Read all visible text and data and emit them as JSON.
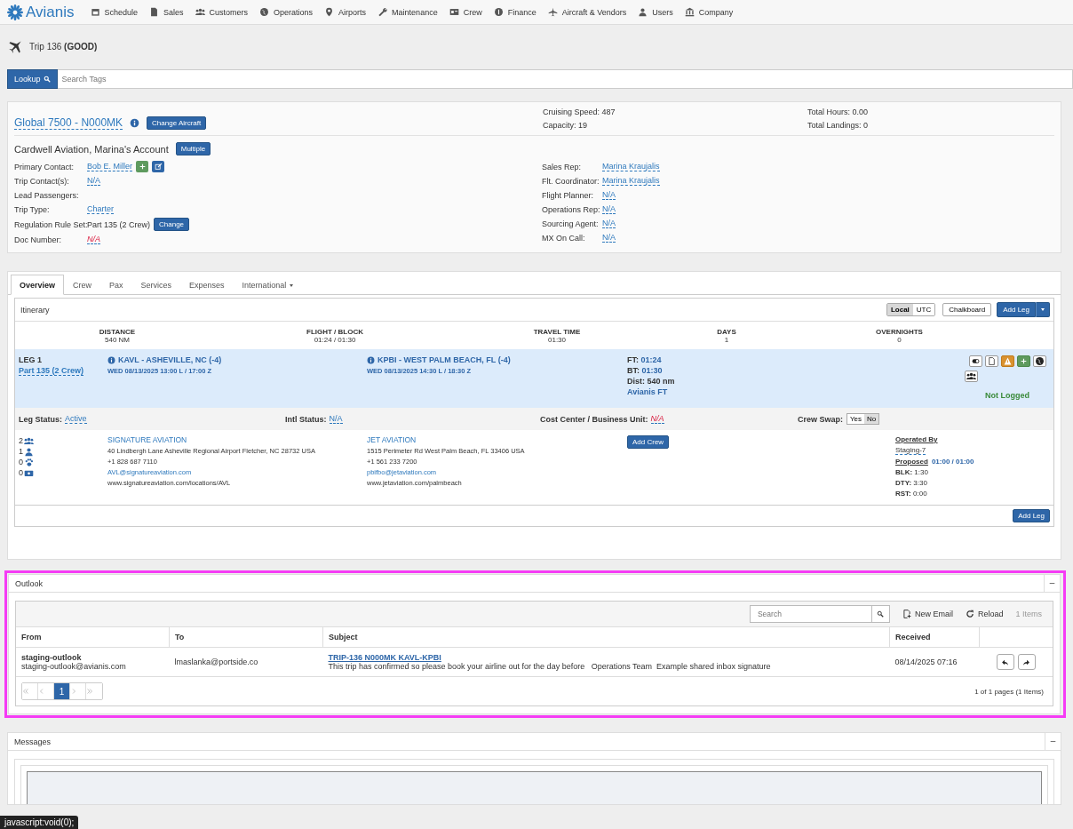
{
  "nav": {
    "logo": "Avianis",
    "items": [
      {
        "label": "Schedule",
        "kind": "calendar"
      },
      {
        "label": "Sales",
        "kind": "document"
      },
      {
        "label": "Customers",
        "kind": "group"
      },
      {
        "label": "Operations",
        "kind": "globe"
      },
      {
        "label": "Airports",
        "kind": "pin"
      },
      {
        "label": "Maintenance",
        "kind": "wrench"
      },
      {
        "label": "Crew",
        "kind": "card"
      },
      {
        "label": "Finance",
        "kind": "coin"
      },
      {
        "label": "Aircraft & Vendors",
        "kind": "plane"
      },
      {
        "label": "Users",
        "kind": "user"
      },
      {
        "label": "Company",
        "kind": "bank"
      }
    ]
  },
  "page_title": {
    "text": "Trip 136",
    "status": "(GOOD)"
  },
  "lookup": {
    "button": "Lookup",
    "placeholder": "Search Tags"
  },
  "trip": {
    "aircraft": "Global 7500 - N000MK",
    "change_aircraft": "Change Aircraft",
    "specs": [
      "Cruising Speed: 487",
      "Capacity: 19"
    ],
    "totals": [
      "Total Hours: 0.00",
      "Total Landings: 0"
    ],
    "account": "Cardwell Aviation, Marina's Account",
    "account_button": "Multiple",
    "left_fields": [
      {
        "label": "Primary Contact:",
        "value": "Bob E. Miller",
        "kind": "link",
        "actions": [
          {
            "kind": "add"
          },
          {
            "kind": "edit"
          }
        ]
      },
      {
        "label": "Trip Contact(s):",
        "value": "N/A",
        "kind": "link"
      },
      {
        "label": "Lead Passengers:",
        "kind": "empty"
      },
      {
        "label": "Trip Type:",
        "value": "Charter",
        "kind": "link"
      },
      {
        "label": "Regulation Rule Set:",
        "value": "Part 135 (2 Crew)",
        "kind": "plain",
        "button": "Change"
      },
      {
        "label": "Doc Number:",
        "value": "N/A",
        "kind": "missing"
      }
    ],
    "right_fields": [
      {
        "label": "Sales Rep:",
        "value": "Marina Kraujalis",
        "kind": "link"
      },
      {
        "label": "Flt. Coordinator:",
        "value": "Marina Kraujalis",
        "kind": "link"
      },
      {
        "label": "Flight Planner:",
        "value": "N/A",
        "kind": "link"
      },
      {
        "label": "Operations Rep:",
        "value": "N/A",
        "kind": "link"
      },
      {
        "label": "Sourcing Agent:",
        "value": "N/A",
        "kind": "link"
      },
      {
        "label": "MX On Call:",
        "value": "N/A",
        "kind": "link"
      }
    ]
  },
  "tabs": [
    {
      "label": "Overview",
      "selected": true,
      "has_menu": false
    },
    {
      "label": "Crew",
      "selected": false,
      "has_menu": false
    },
    {
      "label": "Pax",
      "selected": false,
      "has_menu": false
    },
    {
      "label": "Services",
      "selected": false,
      "has_menu": false
    },
    {
      "label": "Expenses",
      "selected": false,
      "has_menu": false
    },
    {
      "label": "International",
      "selected": false,
      "has_menu": true
    }
  ],
  "itinerary": {
    "title": "Itinerary",
    "time_modes": [
      {
        "label": "Local",
        "selected": true
      },
      {
        "label": "UTC",
        "selected": false
      }
    ],
    "chalkboard": "Chalkboard",
    "add_leg": "Add Leg",
    "summary": [
      {
        "label": "DISTANCE",
        "value": "540 NM"
      },
      {
        "label": "FLIGHT / BLOCK",
        "value": "01:24 / 01:30"
      },
      {
        "label": "TRAVEL TIME",
        "value": "01:30"
      },
      {
        "label": "DAYS",
        "value": "1"
      },
      {
        "label": "OVERNIGHTS",
        "value": "0"
      }
    ],
    "leg": {
      "title": "LEG 1",
      "rule": "Part 135 (2 Crew)",
      "departure": {
        "airport": "KAVL - ASHEVILLE, NC (-4)",
        "time": "WED 08/13/2025 13:00 L / 17:00 Z"
      },
      "arrival": {
        "airport": "KPBI - WEST PALM BEACH, FL (-4)",
        "time": "WED 08/13/2025 14:30 L / 18:30 Z"
      },
      "ft_label": "FT:",
      "ft": "01:24",
      "bt_label": "BT:",
      "bt": "01:30",
      "distance": "Dist: 540 nm",
      "provider": "Avianis FT",
      "log_status": "Not Logged",
      "leg_status_label": "Leg Status:",
      "leg_status": "Active",
      "intl_label": "Intl Status:",
      "intl": "N/A",
      "cost_label": "Cost Center / Business Unit:",
      "cost": "N/A",
      "crew_swap_label": "Crew Swap:",
      "crew_swap": [
        {
          "label": "Yes",
          "selected": false
        },
        {
          "label": "No",
          "selected": true
        }
      ],
      "counts": [
        {
          "count": "2",
          "kind": "group"
        },
        {
          "count": "1",
          "kind": "user"
        },
        {
          "count": "0",
          "kind": "paw"
        },
        {
          "count": "0",
          "kind": "ticket"
        }
      ],
      "fbos": [
        {
          "name": "SIGNATURE AVIATION",
          "address": "40 Lindbergh Lane Asheville Regional Airport Fletcher, NC 28732 USA",
          "phone": "+1 828 687 7110",
          "email": "AVL@signatureaviation.com",
          "website": "www.signatureaviation.com/locations/AVL"
        },
        {
          "name": "JET AVIATION",
          "address": "1515 Perimeter Rd West Palm Beach, FL 33406 USA",
          "phone": "+1 561 233 7200",
          "email": "pbifbo@jetaviation.com",
          "website": "www.jetaviation.com/palmbeach"
        }
      ],
      "add_crew": "Add Crew",
      "operated_label": "Operated By",
      "operator": "Staging-7",
      "proposed_label": "Proposed",
      "proposed": "01:00 / 01:00",
      "times": [
        {
          "label": "BLK:",
          "value": "1:30"
        },
        {
          "label": "DTY:",
          "value": "3:30"
        },
        {
          "label": "RST:",
          "value": "0:00"
        }
      ]
    },
    "add_leg_bottom": "Add Leg"
  },
  "outlook": {
    "title": "Outlook",
    "highlighted": true,
    "search_placeholder": "Search",
    "new_email": "New Email",
    "reload": "Reload",
    "count": "1 Items",
    "columns": [
      "From",
      "To",
      "Subject",
      "Received"
    ],
    "rows": [
      {
        "from_name": "staging-outlook",
        "from_email": "staging-outlook@avianis.com",
        "to": "lmaslanka@portside.co",
        "subject": "TRIP-136 N000MK KAVL-KPBI",
        "preview": "This trip has confirmed so please book your airline out for the day before   Operations Team  Example shared inbox signature",
        "received": "08/14/2025 07:16"
      }
    ],
    "pages": [
      {
        "label": "1",
        "selected": true
      }
    ],
    "page_summary": "1 of 1 pages (1 Items)"
  },
  "messages": {
    "title": "Messages"
  },
  "status_tooltip": "javascript:void(0);"
}
